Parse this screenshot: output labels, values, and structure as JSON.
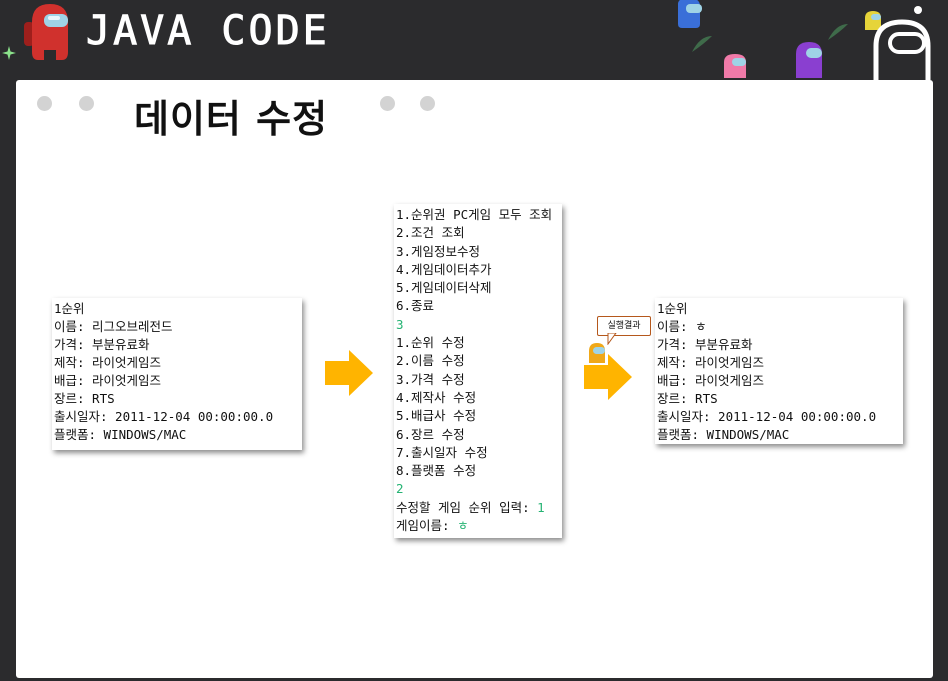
{
  "header": {
    "brand": "JAVA CODE"
  },
  "slide": {
    "title": "데이터 수정"
  },
  "console_before": {
    "lines": [
      "1순위",
      "이름: 리그오브레전드",
      "가격: 부분유료화",
      "제작: 라이엇게임즈",
      "배급: 라이엇게임즈",
      "장르: RTS",
      "출시일자: 2011-12-04 00:00:00.0",
      "플랫폼: WINDOWS/MAC"
    ]
  },
  "console_menu": {
    "lines": [
      "1.순위권 PC게임 모두 조회",
      "2.조건 조회",
      "3.게임정보수정",
      "4.게임데이터추가",
      "5.게임데이터삭제",
      "6.종료"
    ],
    "input1": "3",
    "edit_lines": [
      "1.순위 수정",
      "2.이름 수정",
      "3.가격 수정",
      "4.제작사 수정",
      "5.배급사 수정",
      "6.장르 수정",
      "7.출시일자 수정",
      "8.플랫폼 수정"
    ],
    "input2": "2",
    "prompt_rank": "수정할 게임 순위 입력: ",
    "input_rank": "1",
    "prompt_name": "게임이름: ",
    "input_name": "ㅎ"
  },
  "callout": {
    "label": "실행결과"
  },
  "console_after": {
    "rank": "1순위",
    "name_label": "이름: ",
    "name_value": "ㅎ",
    "lines": [
      "가격: 부분유료화",
      "제작: 라이엇게임즈",
      "배급: 라이엇게임즈",
      "장르: RTS",
      "출시일자: 2011-12-04 00:00:00.0",
      "플랫폼: WINDOWS/MAC"
    ]
  },
  "colors": {
    "background": "#2b2b2d",
    "arrow": "#ffb400",
    "console_input": "#25b373",
    "crewmate_red": "#d0312d"
  },
  "icons": [
    "crewmate-red-icon",
    "crewmate-blue-icon",
    "crewmate-purple-icon",
    "crewmate-pink-icon",
    "crewmate-yellow-icon",
    "crewmate-white-outline-icon"
  ]
}
